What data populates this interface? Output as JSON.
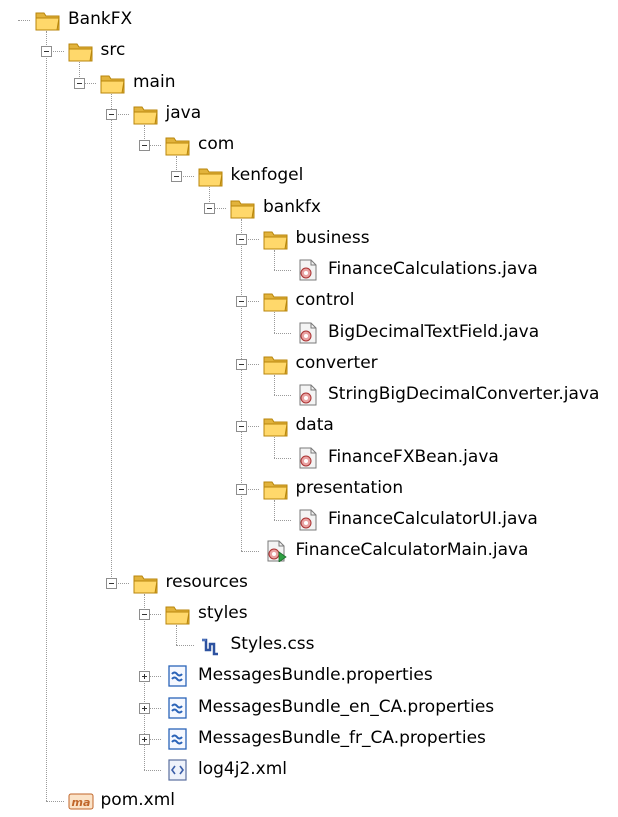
{
  "tree": [
    {
      "label": "BankFX",
      "icon": "folder-icon",
      "level": 0,
      "toggle": "none"
    },
    {
      "label": "src",
      "icon": "folder-icon",
      "level": 1,
      "toggle": "minus"
    },
    {
      "label": "main",
      "icon": "folder-icon",
      "level": 2,
      "toggle": "minus"
    },
    {
      "label": "java",
      "icon": "folder-icon",
      "level": 3,
      "toggle": "minus"
    },
    {
      "label": "com",
      "icon": "folder-icon",
      "level": 4,
      "toggle": "minus"
    },
    {
      "label": "kenfogel",
      "icon": "folder-icon",
      "level": 5,
      "toggle": "minus"
    },
    {
      "label": "bankfx",
      "icon": "folder-icon",
      "level": 6,
      "toggle": "minus"
    },
    {
      "label": "business",
      "icon": "folder-icon",
      "level": 7,
      "toggle": "minus"
    },
    {
      "label": "FinanceCalculations.java",
      "icon": "java-class-icon",
      "level": 8,
      "toggle": "none"
    },
    {
      "label": "control",
      "icon": "folder-icon",
      "level": 7,
      "toggle": "minus"
    },
    {
      "label": "BigDecimalTextField.java",
      "icon": "java-class-icon",
      "level": 8,
      "toggle": "none"
    },
    {
      "label": "converter",
      "icon": "folder-icon",
      "level": 7,
      "toggle": "minus"
    },
    {
      "label": "StringBigDecimalConverter.java",
      "icon": "java-class-icon",
      "level": 8,
      "toggle": "none"
    },
    {
      "label": "data",
      "icon": "folder-icon",
      "level": 7,
      "toggle": "minus"
    },
    {
      "label": "FinanceFXBean.java",
      "icon": "java-class-icon",
      "level": 8,
      "toggle": "none"
    },
    {
      "label": "presentation",
      "icon": "folder-icon",
      "level": 7,
      "toggle": "minus"
    },
    {
      "label": "FinanceCalculatorUI.java",
      "icon": "java-class-icon",
      "level": 8,
      "toggle": "none"
    },
    {
      "label": "FinanceCalculatorMain.java",
      "icon": "java-main-class-icon",
      "level": 7,
      "toggle": "none"
    },
    {
      "label": "resources",
      "icon": "folder-icon",
      "level": 3,
      "toggle": "minus"
    },
    {
      "label": "styles",
      "icon": "folder-icon",
      "level": 4,
      "toggle": "minus"
    },
    {
      "label": "Styles.css",
      "icon": "css-file-icon",
      "level": 5,
      "toggle": "none"
    },
    {
      "label": "MessagesBundle.properties",
      "icon": "properties-file-icon",
      "level": 4,
      "toggle": "plus"
    },
    {
      "label": "MessagesBundle_en_CA.properties",
      "icon": "properties-file-icon",
      "level": 4,
      "toggle": "plus"
    },
    {
      "label": "MessagesBundle_fr_CA.properties",
      "icon": "properties-file-icon",
      "level": 4,
      "toggle": "plus"
    },
    {
      "label": "log4j2.xml",
      "icon": "xml-file-icon",
      "level": 4,
      "toggle": "none"
    },
    {
      "label": "pom.xml",
      "icon": "maven-pom-icon",
      "level": 1,
      "toggle": "none"
    }
  ],
  "colors": {
    "folder_back": "#e2b33c",
    "folder_front": "#ffd86b",
    "folder_border": "#b8860b",
    "tree_line": "#9a9a9a",
    "properties_blue": "#2a63b8",
    "java_green": "#2ea043",
    "maven_orange": "#c0662a"
  }
}
